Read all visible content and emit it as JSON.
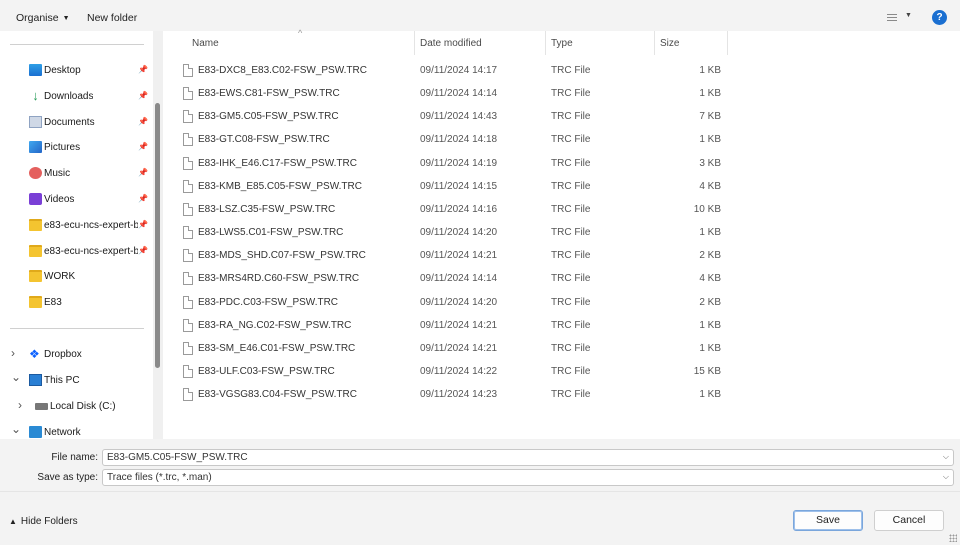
{
  "toolbar": {
    "organise": "Organise",
    "new_folder": "New folder",
    "help": "?"
  },
  "nav": {
    "quick_access": [
      {
        "label": "Desktop",
        "icon": "desktop-icon"
      },
      {
        "label": "Downloads",
        "icon": "downloads-icon"
      },
      {
        "label": "Documents",
        "icon": "documents-icon"
      },
      {
        "label": "Pictures",
        "icon": "pictures-icon"
      },
      {
        "label": "Music",
        "icon": "music-icon"
      },
      {
        "label": "Videos",
        "icon": "videos-icon"
      },
      {
        "label": "e83-ecu-ncs-expert-b",
        "icon": "folder-icon"
      },
      {
        "label": "e83-ecu-ncs-expert-b",
        "icon": "folder-icon"
      },
      {
        "label": "WORK",
        "icon": "folder-icon"
      },
      {
        "label": "E83",
        "icon": "folder-icon"
      }
    ],
    "tree": [
      {
        "label": "Dropbox",
        "icon": "dropbox-icon",
        "expanded": false
      },
      {
        "label": "This PC",
        "icon": "pc-icon",
        "expanded": true
      },
      {
        "label": "Local Disk (C:)",
        "icon": "disk-icon",
        "expanded": false
      },
      {
        "label": "Network",
        "icon": "network-icon",
        "expanded": true
      }
    ]
  },
  "columns": {
    "name": "Name",
    "date": "Date modified",
    "type": "Type",
    "size": "Size"
  },
  "files": [
    {
      "name": "E83-DXC8_E83.C02-FSW_PSW.TRC",
      "date": "09/11/2024 14:17",
      "type": "TRC File",
      "size": "1 KB"
    },
    {
      "name": "E83-EWS.C81-FSW_PSW.TRC",
      "date": "09/11/2024 14:14",
      "type": "TRC File",
      "size": "1 KB"
    },
    {
      "name": "E83-GM5.C05-FSW_PSW.TRC",
      "date": "09/11/2024 14:43",
      "type": "TRC File",
      "size": "7 KB"
    },
    {
      "name": "E83-GT.C08-FSW_PSW.TRC",
      "date": "09/11/2024 14:18",
      "type": "TRC File",
      "size": "1 KB"
    },
    {
      "name": "E83-IHK_E46.C17-FSW_PSW.TRC",
      "date": "09/11/2024 14:19",
      "type": "TRC File",
      "size": "3 KB"
    },
    {
      "name": "E83-KMB_E85.C05-FSW_PSW.TRC",
      "date": "09/11/2024 14:15",
      "type": "TRC File",
      "size": "4 KB"
    },
    {
      "name": "E83-LSZ.C35-FSW_PSW.TRC",
      "date": "09/11/2024 14:16",
      "type": "TRC File",
      "size": "10 KB"
    },
    {
      "name": "E83-LWS5.C01-FSW_PSW.TRC",
      "date": "09/11/2024 14:20",
      "type": "TRC File",
      "size": "1 KB"
    },
    {
      "name": "E83-MDS_SHD.C07-FSW_PSW.TRC",
      "date": "09/11/2024 14:21",
      "type": "TRC File",
      "size": "2 KB"
    },
    {
      "name": "E83-MRS4RD.C60-FSW_PSW.TRC",
      "date": "09/11/2024 14:14",
      "type": "TRC File",
      "size": "4 KB"
    },
    {
      "name": "E83-PDC.C03-FSW_PSW.TRC",
      "date": "09/11/2024 14:20",
      "type": "TRC File",
      "size": "2 KB"
    },
    {
      "name": "E83-RA_NG.C02-FSW_PSW.TRC",
      "date": "09/11/2024 14:21",
      "type": "TRC File",
      "size": "1 KB"
    },
    {
      "name": "E83-SM_E46.C01-FSW_PSW.TRC",
      "date": "09/11/2024 14:21",
      "type": "TRC File",
      "size": "1 KB"
    },
    {
      "name": "E83-ULF.C03-FSW_PSW.TRC",
      "date": "09/11/2024 14:22",
      "type": "TRC File",
      "size": "15 KB"
    },
    {
      "name": "E83-VGSG83.C04-FSW_PSW.TRC",
      "date": "09/11/2024 14:23",
      "type": "TRC File",
      "size": "1 KB"
    }
  ],
  "file_name": {
    "label": "File name:",
    "value": "E83-GM5.C05-FSW_PSW.TRC"
  },
  "save_type": {
    "label": "Save as type:",
    "value": "Trace files (*.trc, *.man)"
  },
  "footer": {
    "hide_folders": "Hide Folders",
    "save": "Save",
    "cancel": "Cancel"
  },
  "colors": {
    "accent": "#1a6fd1",
    "folder": "#f4c430"
  }
}
